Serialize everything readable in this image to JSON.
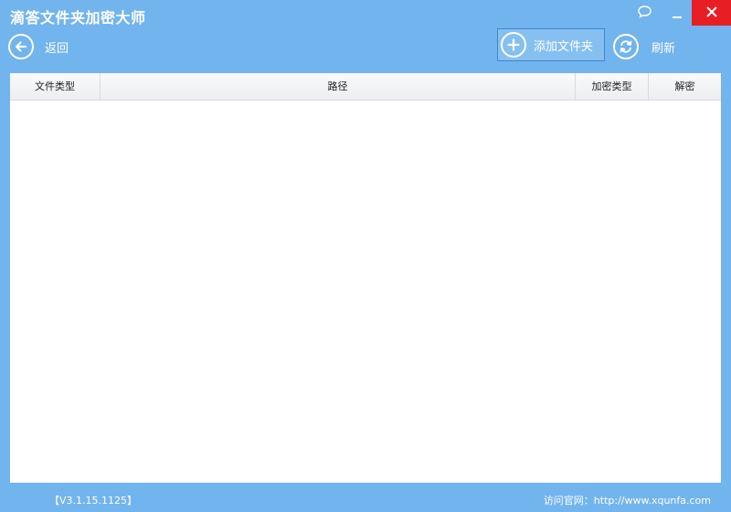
{
  "app": {
    "title": "滴答文件夹加密大师"
  },
  "toolbar": {
    "back_label": "返回",
    "add_folder_label": "添加文件夹",
    "refresh_label": "刷新"
  },
  "table": {
    "columns": [
      "文件类型",
      "路径",
      "加密类型",
      "解密"
    ],
    "rows": []
  },
  "footer": {
    "version": "【V3.1.15.1125】",
    "website": "访问官网：http://www.xqunfa.com"
  },
  "icons": {
    "feedback": "chat-bubble-icon",
    "minimize": "minimize-icon",
    "close": "close-icon",
    "back": "arrow-left-circle-icon",
    "add": "plus-circle-icon",
    "refresh": "refresh-circle-icon"
  },
  "colors": {
    "window_bg": "#72b4ee",
    "close_button": "#e81e25",
    "panel_bg": "#ffffff"
  }
}
